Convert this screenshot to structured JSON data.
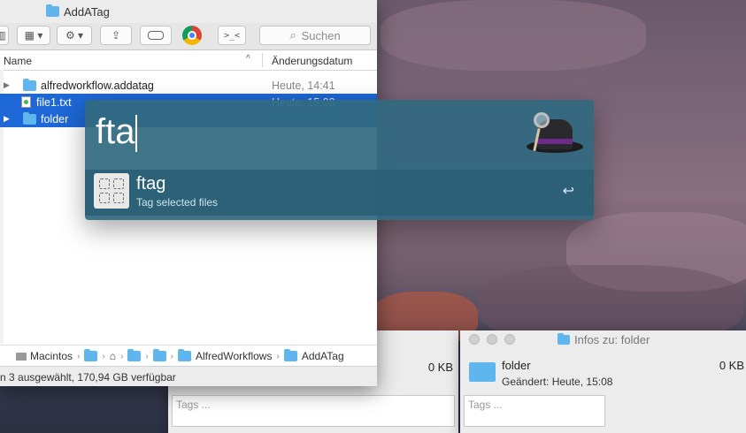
{
  "finder": {
    "title": "AddATag",
    "search_placeholder": "Suchen",
    "columns": {
      "name": "Name",
      "date": "Änderungsdatum"
    },
    "rows": [
      {
        "name": "alfredworkflow.addatag",
        "date": "Heute, 14:41",
        "kind": "folder",
        "selected": false
      },
      {
        "name": "file1.txt",
        "date": "Heute, 15:08",
        "kind": "file",
        "selected": true
      },
      {
        "name": "folder",
        "date": "",
        "kind": "folder",
        "selected": true
      }
    ],
    "path": [
      "Macintos",
      "AlfredWorkflows",
      "AddATag"
    ],
    "status": "n 3 ausgewählt, 170,94 GB verfügbar"
  },
  "alfred": {
    "query": "fta",
    "result_title": "ftag",
    "result_subtitle": "Tag selected files",
    "enter_symbol": "↩"
  },
  "info_left": {
    "size": "0 KB",
    "tags_placeholder": "Tags ..."
  },
  "info_right": {
    "title": "Infos zu: folder",
    "name": "folder",
    "size": "0 KB",
    "modified": "Geändert: Heute, 15:08",
    "tags_placeholder": "Tags ..."
  },
  "colors": {
    "selection": "#1e67d6",
    "alfred_bg": "#306980",
    "folder": "#5fb6ef"
  }
}
